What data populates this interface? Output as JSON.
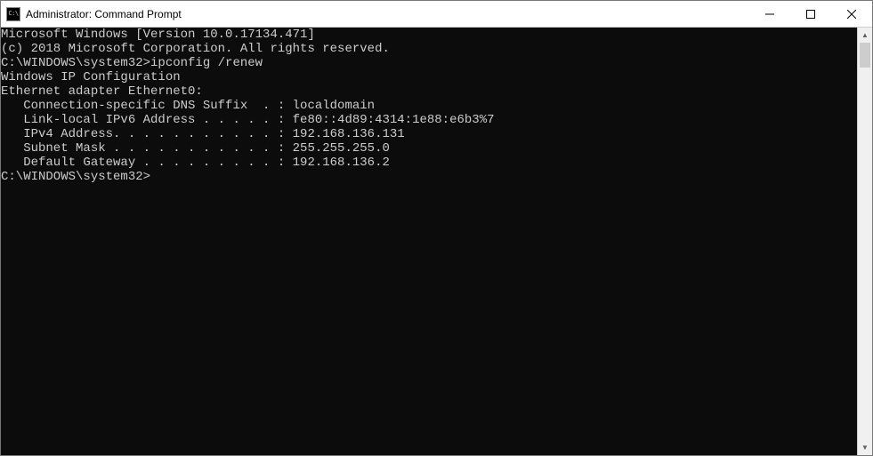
{
  "titlebar": {
    "icon_text": "C:\\",
    "title": "Administrator: Command Prompt"
  },
  "terminal": {
    "lines": [
      "Microsoft Windows [Version 10.0.17134.471]",
      "(c) 2018 Microsoft Corporation. All rights reserved.",
      "",
      "C:\\WINDOWS\\system32>ipconfig /renew",
      "",
      "Windows IP Configuration",
      "",
      "",
      "Ethernet adapter Ethernet0:",
      "",
      "   Connection-specific DNS Suffix  . : localdomain",
      "   Link-local IPv6 Address . . . . . : fe80::4d89:4314:1e88:e6b3%7",
      "   IPv4 Address. . . . . . . . . . . : 192.168.136.131",
      "   Subnet Mask . . . . . . . . . . . : 255.255.255.0",
      "   Default Gateway . . . . . . . . . : 192.168.136.2",
      "",
      "C:\\WINDOWS\\system32>"
    ]
  }
}
